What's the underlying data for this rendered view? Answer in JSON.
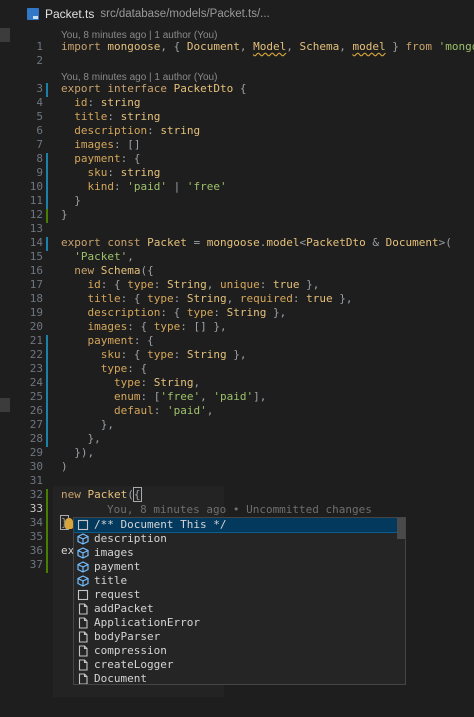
{
  "breadcrumb": {
    "file": "Packet.ts",
    "path": "src/database/models/Packet.ts/..."
  },
  "codelens": {
    "import": "You, 8 minutes ago | 1 author (You)",
    "interface": "You, 8 minutes ago | 1 author (You)"
  },
  "ghost_text": "You, 8 minutes ago • Uncommitted changes",
  "lines": [
    {
      "n": "1",
      "text": "import mongoose, { Document, Model, Schema, model } from 'mongoose'"
    },
    {
      "n": "2",
      "text": ""
    },
    {
      "n": "3",
      "text": "export interface PacketDto {"
    },
    {
      "n": "4",
      "text": "  id: string"
    },
    {
      "n": "5",
      "text": "  title: string"
    },
    {
      "n": "6",
      "text": "  description: string"
    },
    {
      "n": "7",
      "text": "  images: []"
    },
    {
      "n": "8",
      "text": "  payment: {"
    },
    {
      "n": "9",
      "text": "    sku: string"
    },
    {
      "n": "10",
      "text": "    kind: 'paid' | 'free'"
    },
    {
      "n": "11",
      "text": "  }"
    },
    {
      "n": "12",
      "text": "}"
    },
    {
      "n": "13",
      "text": ""
    },
    {
      "n": "14",
      "text": "export const Packet = mongoose.model<PacketDto & Document>("
    },
    {
      "n": "15",
      "text": "  'Packet',"
    },
    {
      "n": "16",
      "text": "  new Schema({"
    },
    {
      "n": "17",
      "text": "    id: { type: String, unique: true },"
    },
    {
      "n": "18",
      "text": "    title: { type: String, required: true },"
    },
    {
      "n": "19",
      "text": "    description: { type: String },"
    },
    {
      "n": "20",
      "text": "    images: { type: [] },"
    },
    {
      "n": "21",
      "text": "    payment: {"
    },
    {
      "n": "22",
      "text": "      sku: { type: String },"
    },
    {
      "n": "23",
      "text": "      type: {"
    },
    {
      "n": "24",
      "text": "        type: String,"
    },
    {
      "n": "25",
      "text": "        enum: ['free', 'paid'],"
    },
    {
      "n": "26",
      "text": "        defaul: 'paid',"
    },
    {
      "n": "27",
      "text": "      },"
    },
    {
      "n": "28",
      "text": "    },"
    },
    {
      "n": "29",
      "text": "  }),"
    },
    {
      "n": "30",
      "text": ")"
    },
    {
      "n": "31",
      "text": ""
    },
    {
      "n": "32",
      "text": "new Packet({"
    },
    {
      "n": "33",
      "text": ""
    },
    {
      "n": "34",
      "text": "})"
    },
    {
      "n": "35",
      "text": ""
    },
    {
      "n": "36",
      "text": "ex"
    },
    {
      "n": "37",
      "text": ""
    }
  ],
  "suggestions": [
    {
      "label": "/** Document This */",
      "icon": "snippet-icon"
    },
    {
      "label": "description",
      "icon": "property-icon"
    },
    {
      "label": "images",
      "icon": "property-icon"
    },
    {
      "label": "payment",
      "icon": "property-icon"
    },
    {
      "label": "title",
      "icon": "property-icon"
    },
    {
      "label": "request",
      "icon": "snippet-icon"
    },
    {
      "label": "addPacket",
      "icon": "file-icon"
    },
    {
      "label": "ApplicationError",
      "icon": "file-icon"
    },
    {
      "label": "bodyParser",
      "icon": "file-icon"
    },
    {
      "label": "compression",
      "icon": "file-icon"
    },
    {
      "label": "createLogger",
      "icon": "file-icon"
    },
    {
      "label": "Document",
      "icon": "file-icon"
    }
  ],
  "colors": {
    "keyword": "#c9a26d",
    "string": "#9dc16a",
    "type": "#e4c07b",
    "selection": "#04395e",
    "git_modified": "#1b81a8",
    "git_added": "#487e02"
  }
}
